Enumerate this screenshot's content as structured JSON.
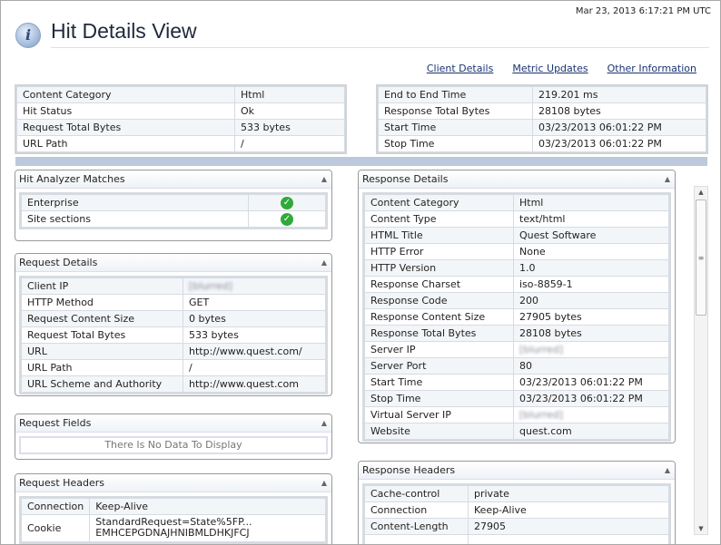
{
  "timestamp": "Mar 23, 2013 6:17:21 PM UTC",
  "title": "Hit Details View",
  "links": [
    "Client Details",
    "Metric Updates",
    "Other Information"
  ],
  "summary_left": [
    [
      "Content Category",
      "Html"
    ],
    [
      "Hit Status",
      "Ok"
    ],
    [
      "Request Total Bytes",
      "533 bytes"
    ],
    [
      "URL Path",
      "/"
    ]
  ],
  "summary_right": [
    [
      "End to End Time",
      "219.201 ms"
    ],
    [
      "Response Total Bytes",
      "28108 bytes"
    ],
    [
      "Start Time",
      "03/23/2013 06:01:22 PM"
    ],
    [
      "Stop Time",
      "03/23/2013 06:01:22 PM"
    ]
  ],
  "panels": {
    "hit_analyzer": {
      "title": "Hit Analyzer Matches",
      "rows": [
        [
          "Enterprise",
          "check-icon"
        ],
        [
          "Site sections",
          "check-icon"
        ]
      ]
    },
    "request_details": {
      "title": "Request Details",
      "rows": [
        [
          "Client IP",
          "[blurred]"
        ],
        [
          "HTTP Method",
          "GET"
        ],
        [
          "Request Content Size",
          "0 bytes"
        ],
        [
          "Request Total Bytes",
          "533 bytes"
        ],
        [
          "URL",
          "http://www.quest.com/"
        ],
        [
          "URL Path",
          "/"
        ],
        [
          "URL Scheme and Authority",
          "http://www.quest.com"
        ]
      ]
    },
    "request_fields": {
      "title": "Request Fields",
      "empty": "There Is No Data To Display"
    },
    "request_headers": {
      "title": "Request Headers",
      "rows": [
        [
          "Connection",
          "Keep-Alive"
        ],
        [
          "Cookie",
          "StandardRequest=State%5FP...\nEMHCEPGDNAJHNIBMLDHKJFCJ"
        ]
      ]
    },
    "response_details": {
      "title": "Response Details",
      "rows": [
        [
          "Content Category",
          "Html"
        ],
        [
          "Content Type",
          "text/html"
        ],
        [
          "HTML Title",
          "Quest Software"
        ],
        [
          "HTTP Error",
          "None"
        ],
        [
          "HTTP Version",
          "1.0"
        ],
        [
          "Response Charset",
          "iso-8859-1"
        ],
        [
          "Response Code",
          "200"
        ],
        [
          "Response Content Size",
          "27905 bytes"
        ],
        [
          "Response Total Bytes",
          "28108 bytes"
        ],
        [
          "Server IP",
          "[blurred]"
        ],
        [
          "Server Port",
          "80"
        ],
        [
          "Start Time",
          "03/23/2013 06:01:22 PM"
        ],
        [
          "Stop Time",
          "03/23/2013 06:01:22 PM"
        ],
        [
          "Virtual Server IP",
          "[blurred]"
        ],
        [
          "Website",
          "quest.com"
        ]
      ]
    },
    "response_headers": {
      "title": "Response Headers",
      "rows": [
        [
          "Cache-control",
          "private"
        ],
        [
          "Connection",
          "Keep-Alive"
        ],
        [
          "Content-Length",
          "27905"
        ],
        [
          "",
          ""
        ]
      ]
    }
  }
}
